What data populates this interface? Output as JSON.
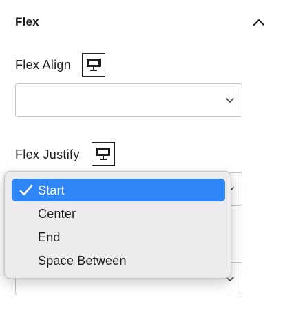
{
  "panel": {
    "title": "Flex",
    "collapse_icon": "chevron-up-icon"
  },
  "fields": {
    "flex_align": {
      "label": "Flex Align",
      "device_icon": "desktop-icon",
      "value": ""
    },
    "flex_justify": {
      "label": "Flex Justify",
      "device_icon": "desktop-icon",
      "value": "Start"
    },
    "third_select": {
      "value": ""
    }
  },
  "dropdown": {
    "options": [
      {
        "label": "Start",
        "selected": true
      },
      {
        "label": "Center",
        "selected": false
      },
      {
        "label": "End",
        "selected": false
      },
      {
        "label": "Space Between",
        "selected": false
      }
    ],
    "check_icon": "checkmark-icon"
  },
  "colors": {
    "selection": "#2f86f6",
    "menu_background": "#eceaec",
    "text": "#1e1e1e",
    "border": "#c4c4c4"
  }
}
